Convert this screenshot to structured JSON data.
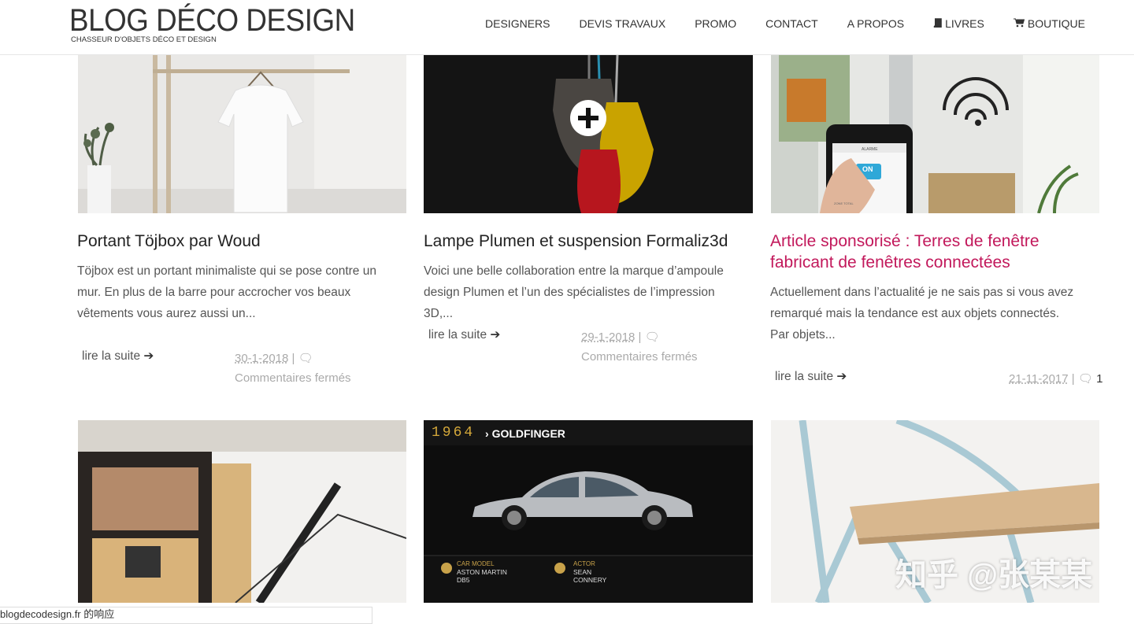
{
  "header": {
    "title": "BLOG DÉCO DESIGN",
    "subtitle": "CHASSEUR D'OBJETS DÉCO ET DESIGN",
    "nav": [
      {
        "label": "DESIGNERS",
        "icon": ""
      },
      {
        "label": "DEVIS TRAVAUX",
        "icon": ""
      },
      {
        "label": "PROMO",
        "icon": ""
      },
      {
        "label": "CONTACT",
        "icon": ""
      },
      {
        "label": "A PROPOS",
        "icon": ""
      },
      {
        "label": "LIVRES",
        "icon": "book-icon"
      },
      {
        "label": "BOUTIQUE",
        "icon": "cart-icon"
      }
    ]
  },
  "posts": [
    {
      "title": "Portant Töjbox par Woud",
      "excerpt": "Töjbox est un portant minimaliste qui se pose contre un mur. En plus de la barre pour accrocher vos beaux vêtements vous aurez aussi un...",
      "read_more": "lire la suite",
      "date": "30-1-2018",
      "comments": "Commentaires fermés"
    },
    {
      "title": "Lampe Plumen et suspension Formaliz3d",
      "excerpt": "Voici une belle collaboration entre la marque d’ampoule design Plumen et l’un des spécialistes de l’impression 3D,...",
      "read_more": "lire la suite",
      "date": "29-1-2018",
      "comments": "Commentaires fermés"
    },
    {
      "title": "Article sponsorisé : Terres de fenêtre fabricant de fenêtres connectées",
      "excerpt": "Actuellement dans l’actualité je ne sais pas si vous avez remarqué mais la tendance est aux objets connectés. Par objets...",
      "read_more": "lire la suite",
      "date": "21-11-2017",
      "comments": "1"
    }
  ],
  "car_image": {
    "year": "1964",
    "film": "GOLDFINGER",
    "car_model_label": "CAR MODEL",
    "car_model": "ASTON MARTIN DB5",
    "actor_label": "ACTOR",
    "actor": "SEAN CONNERY"
  },
  "phone_screen": {
    "app": "ALARME",
    "toggle": "ON",
    "zone": "ZONE TOTAL"
  },
  "status_bar": "blogdecodesign.fr 的响应",
  "watermark": "知乎 @张某某"
}
